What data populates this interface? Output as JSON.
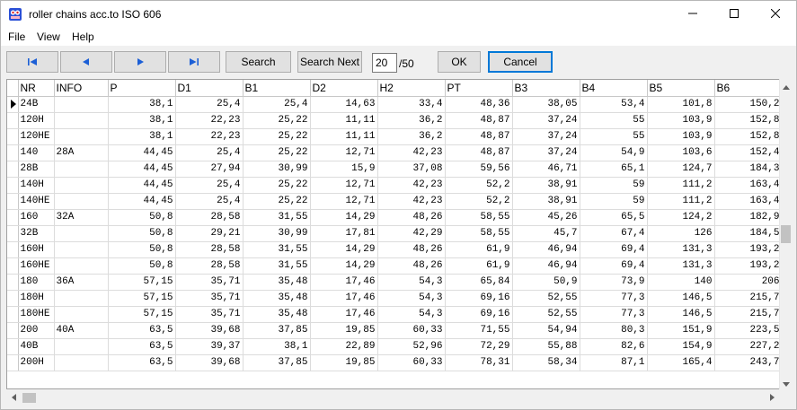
{
  "window": {
    "title": "roller chains acc.to ISO 606"
  },
  "menu": {
    "file": "File",
    "view": "View",
    "help": "Help"
  },
  "toolbar": {
    "search": "Search",
    "search_next": "Search Next",
    "page_current": "20",
    "page_total": "/50",
    "ok": "OK",
    "cancel": "Cancel"
  },
  "icons": {
    "first": "first-record-icon",
    "prev": "previous-record-icon",
    "next": "next-record-icon",
    "last": "last-record-icon"
  },
  "grid": {
    "columns": [
      "NR",
      "INFO",
      "P",
      "D1",
      "B1",
      "D2",
      "H2",
      "PT",
      "B3",
      "B4",
      "B5",
      "B6"
    ],
    "current_row": 0,
    "rows": [
      [
        "24B",
        "",
        "38,1",
        "25,4",
        "25,4",
        "14,63",
        "33,4",
        "48,36",
        "38,05",
        "53,4",
        "101,8",
        "150,2"
      ],
      [
        "120H",
        "",
        "38,1",
        "22,23",
        "25,22",
        "11,11",
        "36,2",
        "48,87",
        "37,24",
        "55",
        "103,9",
        "152,8"
      ],
      [
        "120HE",
        "",
        "38,1",
        "22,23",
        "25,22",
        "11,11",
        "36,2",
        "48,87",
        "37,24",
        "55",
        "103,9",
        "152,8"
      ],
      [
        "140",
        "28A",
        "44,45",
        "25,4",
        "25,22",
        "12,71",
        "42,23",
        "48,87",
        "37,24",
        "54,9",
        "103,6",
        "152,4"
      ],
      [
        "28B",
        "",
        "44,45",
        "27,94",
        "30,99",
        "15,9",
        "37,08",
        "59,56",
        "46,71",
        "65,1",
        "124,7",
        "184,3"
      ],
      [
        "140H",
        "",
        "44,45",
        "25,4",
        "25,22",
        "12,71",
        "42,23",
        "52,2",
        "38,91",
        "59",
        "111,2",
        "163,4"
      ],
      [
        "140HE",
        "",
        "44,45",
        "25,4",
        "25,22",
        "12,71",
        "42,23",
        "52,2",
        "38,91",
        "59",
        "111,2",
        "163,4"
      ],
      [
        "160",
        "32A",
        "50,8",
        "28,58",
        "31,55",
        "14,29",
        "48,26",
        "58,55",
        "45,26",
        "65,5",
        "124,2",
        "182,9"
      ],
      [
        "32B",
        "",
        "50,8",
        "29,21",
        "30,99",
        "17,81",
        "42,29",
        "58,55",
        "45,7",
        "67,4",
        "126",
        "184,5"
      ],
      [
        "160H",
        "",
        "50,8",
        "28,58",
        "31,55",
        "14,29",
        "48,26",
        "61,9",
        "46,94",
        "69,4",
        "131,3",
        "193,2"
      ],
      [
        "160HE",
        "",
        "50,8",
        "28,58",
        "31,55",
        "14,29",
        "48,26",
        "61,9",
        "46,94",
        "69,4",
        "131,3",
        "193,2"
      ],
      [
        "180",
        "36A",
        "57,15",
        "35,71",
        "35,48",
        "17,46",
        "54,3",
        "65,84",
        "50,9",
        "73,9",
        "140",
        "206"
      ],
      [
        "180H",
        "",
        "57,15",
        "35,71",
        "35,48",
        "17,46",
        "54,3",
        "69,16",
        "52,55",
        "77,3",
        "146,5",
        "215,7"
      ],
      [
        "180HE",
        "",
        "57,15",
        "35,71",
        "35,48",
        "17,46",
        "54,3",
        "69,16",
        "52,55",
        "77,3",
        "146,5",
        "215,7"
      ],
      [
        "200",
        "40A",
        "63,5",
        "39,68",
        "37,85",
        "19,85",
        "60,33",
        "71,55",
        "54,94",
        "80,3",
        "151,9",
        "223,5"
      ],
      [
        "40B",
        "",
        "63,5",
        "39,37",
        "38,1",
        "22,89",
        "52,96",
        "72,29",
        "55,88",
        "82,6",
        "154,9",
        "227,2"
      ],
      [
        "200H",
        "",
        "63,5",
        "39,68",
        "37,85",
        "19,85",
        "60,33",
        "78,31",
        "58,34",
        "87,1",
        "165,4",
        "243,7"
      ]
    ]
  }
}
